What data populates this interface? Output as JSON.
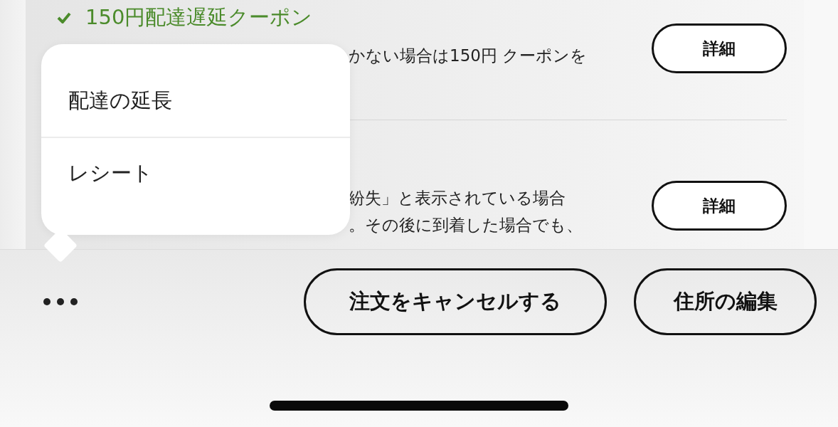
{
  "sections": [
    {
      "kind": "coupon",
      "title": "150円配達遅延クーポン",
      "lines": [
        "かない場合は150円 クーポンを"
      ],
      "button": "詳細"
    },
    {
      "kind": "notice",
      "lines": [
        "紛失」と表示されている場合",
        "。その後に到着した場合でも、"
      ],
      "button": "詳細"
    }
  ],
  "menu": {
    "items": [
      {
        "label": "配達の延長"
      },
      {
        "label": "レシート"
      }
    ]
  },
  "footer": {
    "buttons": [
      "注文をキャンセルする",
      "住所の編集"
    ]
  }
}
